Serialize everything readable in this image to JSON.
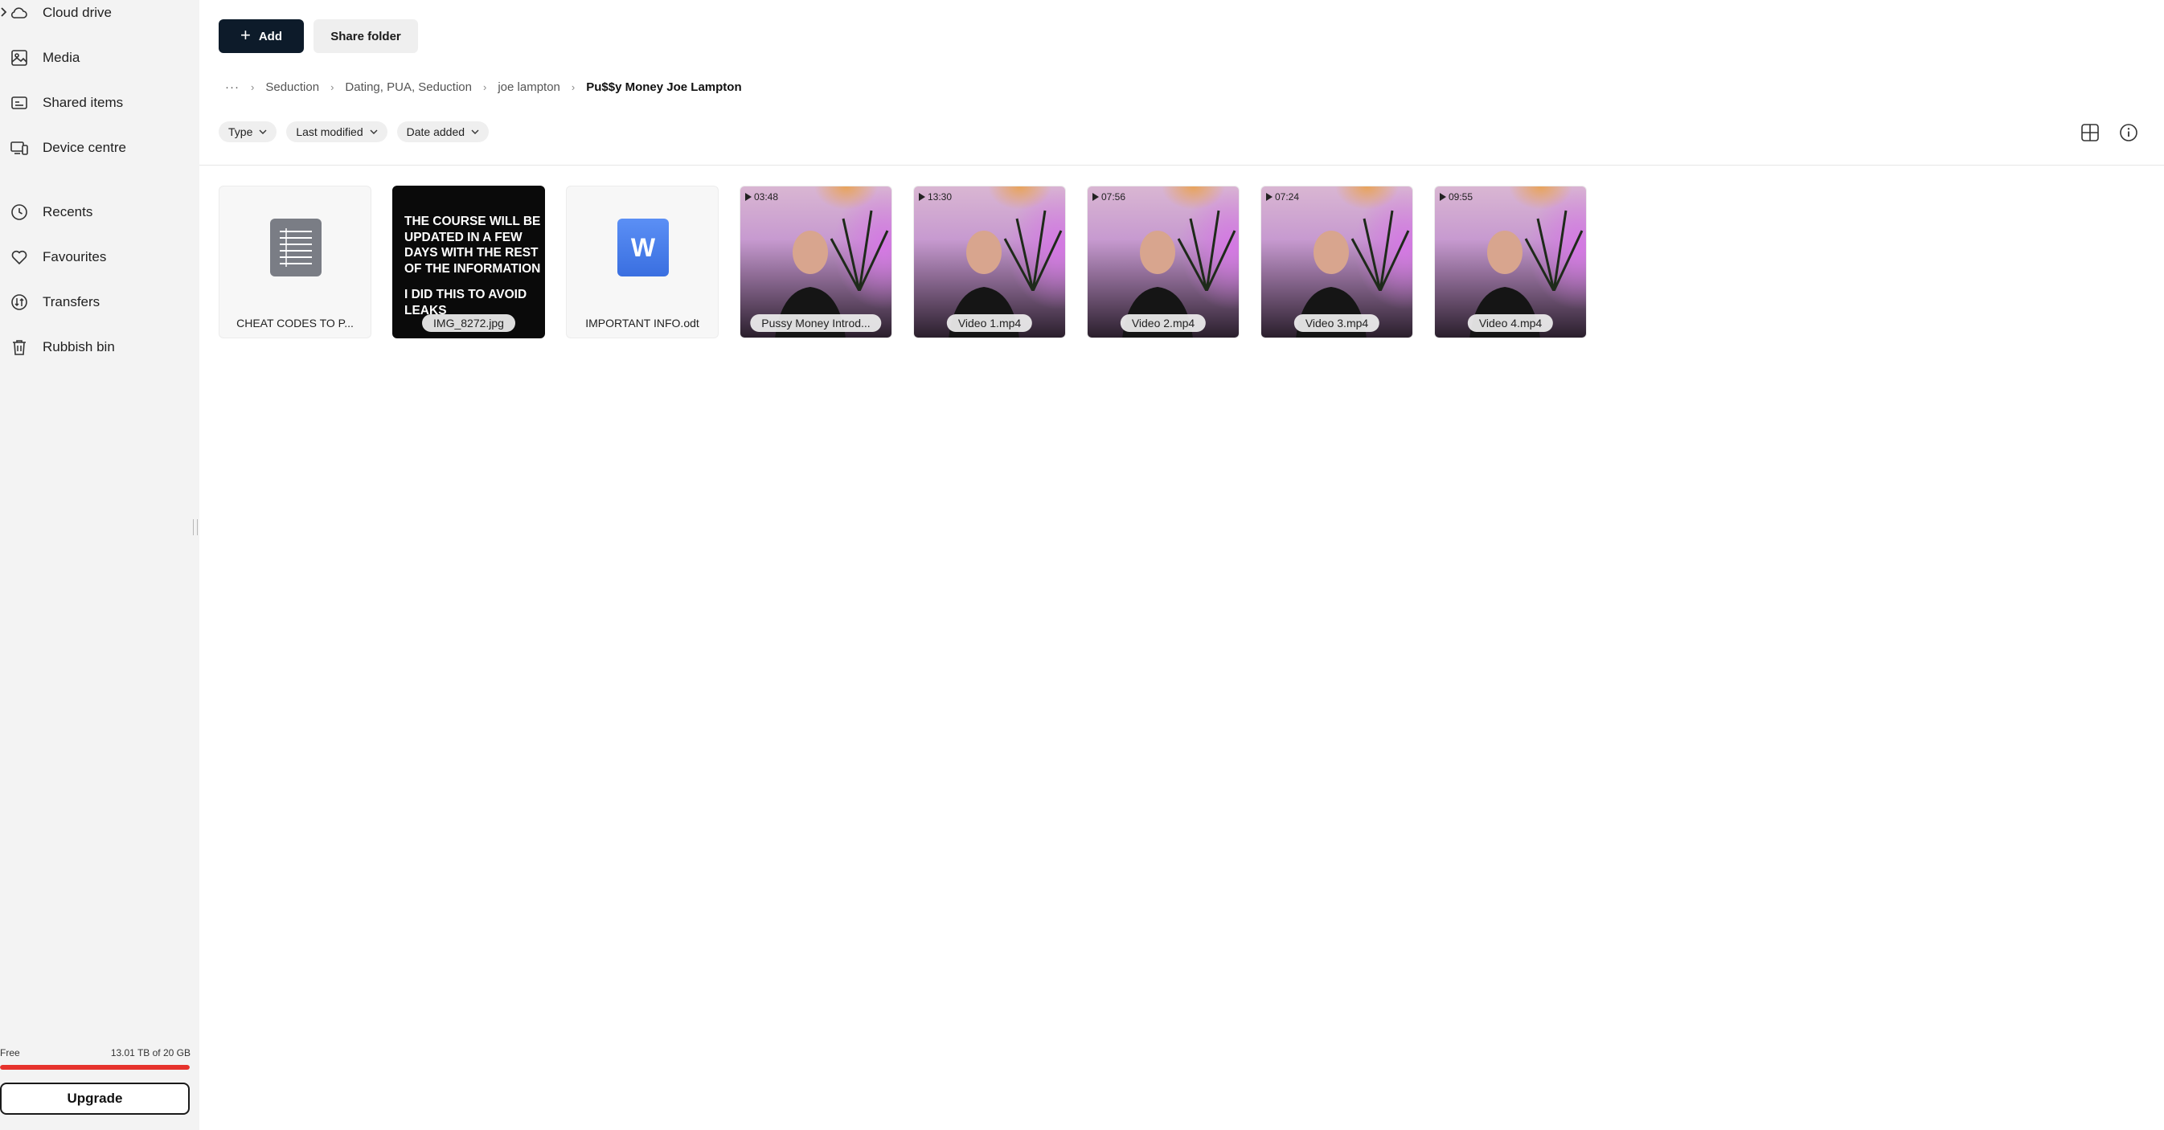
{
  "sidebar": {
    "nav_top": [
      {
        "label": "Cloud drive",
        "icon": "cloud-icon"
      },
      {
        "label": "Media",
        "icon": "image-icon"
      },
      {
        "label": "Shared items",
        "icon": "shared-folder-icon"
      },
      {
        "label": "Device centre",
        "icon": "devices-icon"
      }
    ],
    "nav_bottom": [
      {
        "label": "Recents",
        "icon": "clock-icon"
      },
      {
        "label": "Favourites",
        "icon": "heart-icon"
      },
      {
        "label": "Transfers",
        "icon": "transfers-icon"
      },
      {
        "label": "Rubbish bin",
        "icon": "trash-icon"
      }
    ],
    "storage": {
      "plan": "Free",
      "usage": "13.01 TB of 20 GB",
      "used_fraction": 1.0,
      "bar_color": "#e6332d"
    },
    "upgrade_label": "Upgrade"
  },
  "toolbar": {
    "add_label": "Add",
    "share_label": "Share folder"
  },
  "breadcrumb": {
    "more": "···",
    "items": [
      "Seduction",
      "Dating, PUA, Seduction",
      "joe lampton"
    ],
    "current": "Pu$$y Money Joe Lampton"
  },
  "filters": [
    "Type",
    "Last modified",
    "Date added"
  ],
  "files": {
    "doc": {
      "name": "CHEAT CODES TO P...",
      "icon": "text-document-icon"
    },
    "image": {
      "name": "IMG_8272.jpg",
      "text_lines": [
        "THE COURSE WILL BE UPDATED IN A FEW DAYS WITH THE REST OF THE INFORMATION",
        "I DID THIS TO AVOID LEAKS"
      ]
    },
    "odt": {
      "name": "IMPORTANT INFO.odt",
      "icon": "word-document-icon",
      "letter": "W",
      "color": "#4a7ff0"
    },
    "videos": [
      {
        "name": "Pussy Money Introd...",
        "duration": "03:48"
      },
      {
        "name": "Video 1.mp4",
        "duration": "13:30"
      },
      {
        "name": "Video 2.mp4",
        "duration": "07:56"
      },
      {
        "name": "Video 3.mp4",
        "duration": "07:24"
      },
      {
        "name": "Video 4.mp4",
        "duration": "09:55"
      }
    ]
  },
  "colors": {
    "primary_button": "#0d1b2a",
    "sidebar_bg": "#f3f3f3"
  }
}
